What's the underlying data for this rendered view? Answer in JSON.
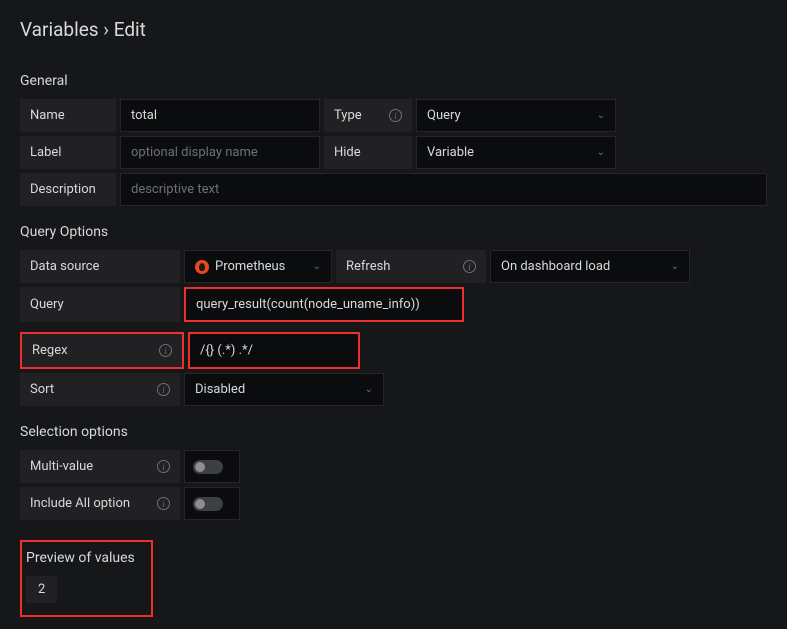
{
  "title": "Variables › Edit",
  "general": {
    "heading": "General",
    "name_label": "Name",
    "name_value": "total",
    "type_label": "Type",
    "type_value": "Query",
    "label_label": "Label",
    "label_placeholder": "optional display name",
    "hide_label": "Hide",
    "hide_value": "Variable",
    "description_label": "Description",
    "description_placeholder": "descriptive text"
  },
  "query": {
    "heading": "Query Options",
    "datasource_label": "Data source",
    "datasource_value": "Prometheus",
    "refresh_label": "Refresh",
    "refresh_value": "On dashboard load",
    "query_label": "Query",
    "query_value": "query_result(count(node_uname_info))",
    "regex_label": "Regex",
    "regex_value": "/{} (.*) .*/",
    "sort_label": "Sort",
    "sort_value": "Disabled"
  },
  "selection": {
    "heading": "Selection options",
    "multi_label": "Multi-value",
    "include_all_label": "Include All option"
  },
  "preview": {
    "heading": "Preview of values",
    "values": [
      "2"
    ]
  }
}
